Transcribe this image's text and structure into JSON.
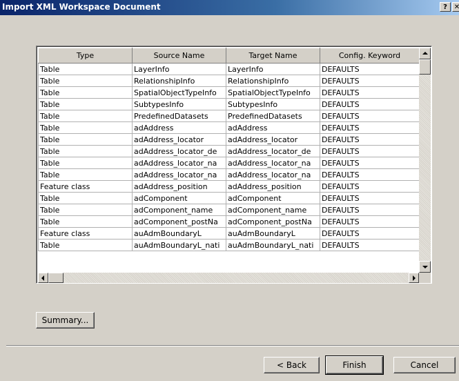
{
  "window": {
    "title": "Import XML Workspace Document",
    "help_glyph": "?",
    "close_glyph": "✕"
  },
  "grid": {
    "columns": [
      "Type",
      "Source Name",
      "Target Name",
      "Config. Keyword"
    ],
    "rows": [
      [
        "Table",
        "LayerInfo",
        "LayerInfo",
        "DEFAULTS"
      ],
      [
        "Table",
        "RelationshipInfo",
        "RelationshipInfo",
        "DEFAULTS"
      ],
      [
        "Table",
        "SpatialObjectTypeInfo",
        "SpatialObjectTypeInfo",
        "DEFAULTS"
      ],
      [
        "Table",
        "SubtypesInfo",
        "SubtypesInfo",
        "DEFAULTS"
      ],
      [
        "Table",
        "PredefinedDatasets",
        "PredefinedDatasets",
        "DEFAULTS"
      ],
      [
        "Table",
        "adAddress",
        "adAddress",
        "DEFAULTS"
      ],
      [
        "Table",
        "adAddress_locator",
        "adAddress_locator",
        "DEFAULTS"
      ],
      [
        "Table",
        "adAddress_locator_de",
        "adAddress_locator_de",
        "DEFAULTS"
      ],
      [
        "Table",
        "adAddress_locator_na",
        "adAddress_locator_na",
        "DEFAULTS"
      ],
      [
        "Table",
        "adAddress_locator_na",
        "adAddress_locator_na",
        "DEFAULTS"
      ],
      [
        "Feature class",
        "adAddress_position",
        "adAddress_position",
        "DEFAULTS"
      ],
      [
        "Table",
        "adComponent",
        "adComponent",
        "DEFAULTS"
      ],
      [
        "Table",
        "adComponent_name",
        "adComponent_name",
        "DEFAULTS"
      ],
      [
        "Table",
        "adComponent_postNa",
        "adComponent_postNa",
        "DEFAULTS"
      ],
      [
        "Feature class",
        "auAdmBoundaryL",
        "auAdmBoundaryL",
        "DEFAULTS"
      ],
      [
        "Table",
        "auAdmBoundaryL_nati",
        "auAdmBoundaryL_nati",
        "DEFAULTS"
      ]
    ]
  },
  "buttons": {
    "summary": "Summary...",
    "back": "< Back",
    "finish": "Finish",
    "cancel": "Cancel"
  }
}
